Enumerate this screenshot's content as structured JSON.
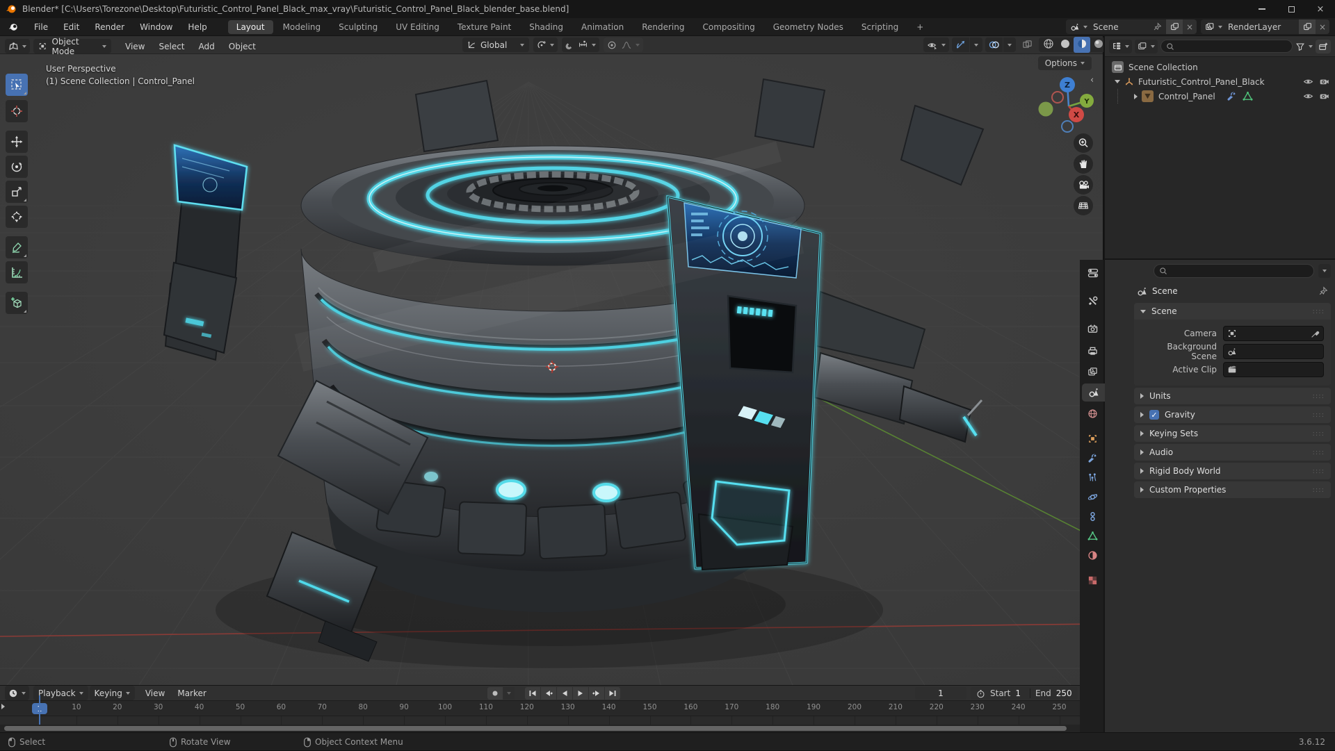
{
  "titlebar": {
    "title": "Blender* [C:\\Users\\Torezone\\Desktop\\Futuristic_Control_Panel_Black_max_vray\\Futuristic_Control_Panel_Black_blender_base.blend]"
  },
  "topbar": {
    "menus": [
      "File",
      "Edit",
      "Render",
      "Window",
      "Help"
    ],
    "tabs": [
      "Layout",
      "Modeling",
      "Sculpting",
      "UV Editing",
      "Texture Paint",
      "Shading",
      "Animation",
      "Rendering",
      "Compositing",
      "Geometry Nodes",
      "Scripting"
    ],
    "active_tab": "Layout",
    "add_tab": "+",
    "scene_selector": {
      "label": "Scene"
    },
    "layer_selector": {
      "label": "RenderLayer"
    }
  },
  "viewport": {
    "header": {
      "mode": "Object Mode",
      "menus": [
        "View",
        "Select",
        "Add",
        "Object"
      ],
      "orientation": "Global",
      "options": "Options"
    },
    "overlay": {
      "line1": "User Perspective",
      "line2": "(1) Scene Collection | Control_Panel"
    },
    "gizmo": {
      "x": "X",
      "y": "Y",
      "z": "Z"
    }
  },
  "outliner": {
    "rows": [
      {
        "label": "Scene Collection",
        "type": "collection"
      },
      {
        "label": "Futuristic_Control_Panel_Black",
        "type": "empty"
      },
      {
        "label": "Control_Panel",
        "type": "mesh"
      }
    ]
  },
  "properties": {
    "breadcrumb": "Scene",
    "scene_panel": {
      "title": "Scene",
      "fields": [
        {
          "label": "Camera"
        },
        {
          "label": "Background Scene"
        },
        {
          "label": "Active Clip"
        }
      ]
    },
    "panels": [
      {
        "label": "Units"
      },
      {
        "label": "Gravity",
        "checkbox": true
      },
      {
        "label": "Keying Sets"
      },
      {
        "label": "Audio"
      },
      {
        "label": "Rigid Body World"
      },
      {
        "label": "Custom Properties"
      }
    ]
  },
  "timeline": {
    "menus": [
      "Playback",
      "Keying",
      "View",
      "Marker"
    ],
    "current_frame": "1",
    "frame_field": "1",
    "start_label": "Start",
    "start_value": "1",
    "end_label": "End",
    "end_value": "250",
    "ticks": [
      10,
      20,
      30,
      40,
      50,
      60,
      70,
      80,
      90,
      100,
      110,
      120,
      130,
      140,
      150,
      160,
      170,
      180,
      190,
      200,
      210,
      220,
      230,
      240,
      250
    ]
  },
  "statusbar": {
    "items": [
      "Select",
      "Rotate View",
      "Object Context Menu"
    ],
    "version": "3.6.12"
  },
  "colors": {
    "accent": "#4772b3",
    "cyan": "#54dbe9",
    "object_orange": "#e0a15c",
    "modifier_blue": "#7ba4dc",
    "data_green": "#57c786"
  }
}
